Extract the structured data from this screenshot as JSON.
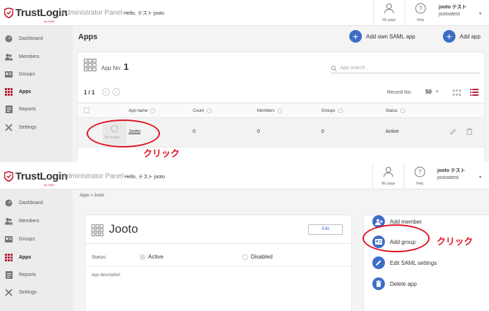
{
  "brand": {
    "name": "TrustLogin",
    "sub": "by GMO"
  },
  "header": {
    "panel_title": "Administrator Panel",
    "hello": "Hello, テスト jooto",
    "mypage_label": "My page",
    "help_label": "Help",
    "user_name": "jooto テスト",
    "user_id": "jootoatest",
    "caret": "▾"
  },
  "sidebar": {
    "items": [
      {
        "label": "Dashboard",
        "icon": "dashboard-icon"
      },
      {
        "label": "Members",
        "icon": "members-icon"
      },
      {
        "label": "Groups",
        "icon": "groups-icon"
      },
      {
        "label": "Apps",
        "icon": "apps-icon",
        "active": true
      },
      {
        "label": "Reports",
        "icon": "reports-icon"
      },
      {
        "label": "Settings",
        "icon": "settings-icon"
      }
    ]
  },
  "apps_page": {
    "title": "Apps",
    "add_saml_label": "Add own SAML app",
    "add_app_label": "Add app",
    "app_no_label": "App No:",
    "app_no_value": "1",
    "search_placeholder": "App search",
    "pagination": "1 / 1",
    "prev": "‹",
    "next": "›",
    "record_label": "Record No:",
    "record_value": "50",
    "columns": [
      "App name",
      "Count",
      "Members",
      "Groups",
      "Status"
    ],
    "rows": [
      {
        "thumb_label": "No image",
        "name": "Jooto",
        "count": "0",
        "members": "0",
        "groups": "0",
        "status": "Active"
      }
    ]
  },
  "detail_page": {
    "breadcrumb": "Apps > Jooto",
    "app_name": "Jooto",
    "edit_label": "Edit",
    "status_label": "Status:",
    "active_label": "Active",
    "disabled_label": "Disabled",
    "description_label": "App description",
    "actions": [
      {
        "label": "Add member",
        "icon": "add-member-icon"
      },
      {
        "label": "Add group",
        "icon": "add-group-icon"
      },
      {
        "label": "Edit SAML settings",
        "icon": "pencil-icon"
      },
      {
        "label": "Delete app",
        "icon": "trash-icon"
      }
    ]
  },
  "annotations": {
    "click_label": "クリック"
  },
  "colors": {
    "accent": "#3d6dc6",
    "annotation": "#e01020",
    "brand_red": "#c8102e"
  }
}
